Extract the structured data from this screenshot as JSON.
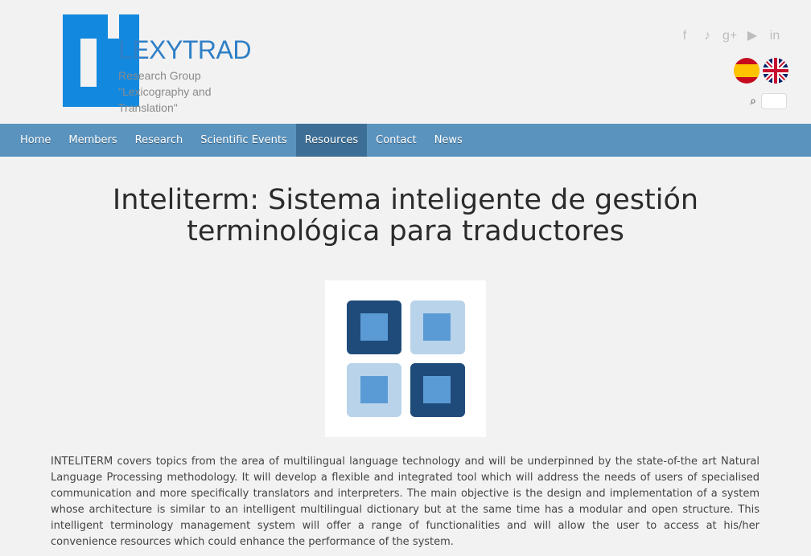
{
  "header": {
    "logo": {
      "name": "LEXYTRAD",
      "subtitle_lines": [
        "Research Group",
        "\"Lexicography and",
        "Translation\""
      ]
    },
    "social_icons": [
      "facebook-icon",
      "twitter-icon",
      "google-plus-icon",
      "youtube-icon",
      "linkedin-icon"
    ],
    "languages": [
      {
        "name": "Spanish",
        "icon": "flag-spain"
      },
      {
        "name": "English",
        "icon": "flag-uk"
      }
    ],
    "search": {
      "value": ""
    }
  },
  "nav": {
    "items": [
      {
        "label": "Home"
      },
      {
        "label": "Members"
      },
      {
        "label": "Research"
      },
      {
        "label": "Scientific Events"
      },
      {
        "label": "Resources",
        "active": true
      },
      {
        "label": "Contact"
      },
      {
        "label": "News"
      }
    ]
  },
  "content": {
    "title_line1": "Inteliterm: Sistema inteligente de gestión",
    "title_line2": "terminológica para traductores",
    "paragraph": "INTELITERM covers topics from the area of multilingual language technology and will be underpinned by the state-of-the art Natural Language Processing methodology. It will develop a flexible and integrated tool which will address the needs of users of specialised communication and more specifically translators and interpreters. The main objective is the design and implementation of a system whose architecture is similar to an intelligent multilingual dictionary but at the same time has a modular and open structure. This intelligent terminology management system will offer a range of functionalities and will allow the user to access at his/her convenience resources which could enhance the performance of the system."
  },
  "colors": {
    "nav_bg": "#5a93be",
    "nav_active": "#3d6f96",
    "logo_blue": "#1289df",
    "hero_dark": "#1f4b7a",
    "hero_light": "#b9d3ea",
    "hero_mid": "#5b9bd5"
  }
}
